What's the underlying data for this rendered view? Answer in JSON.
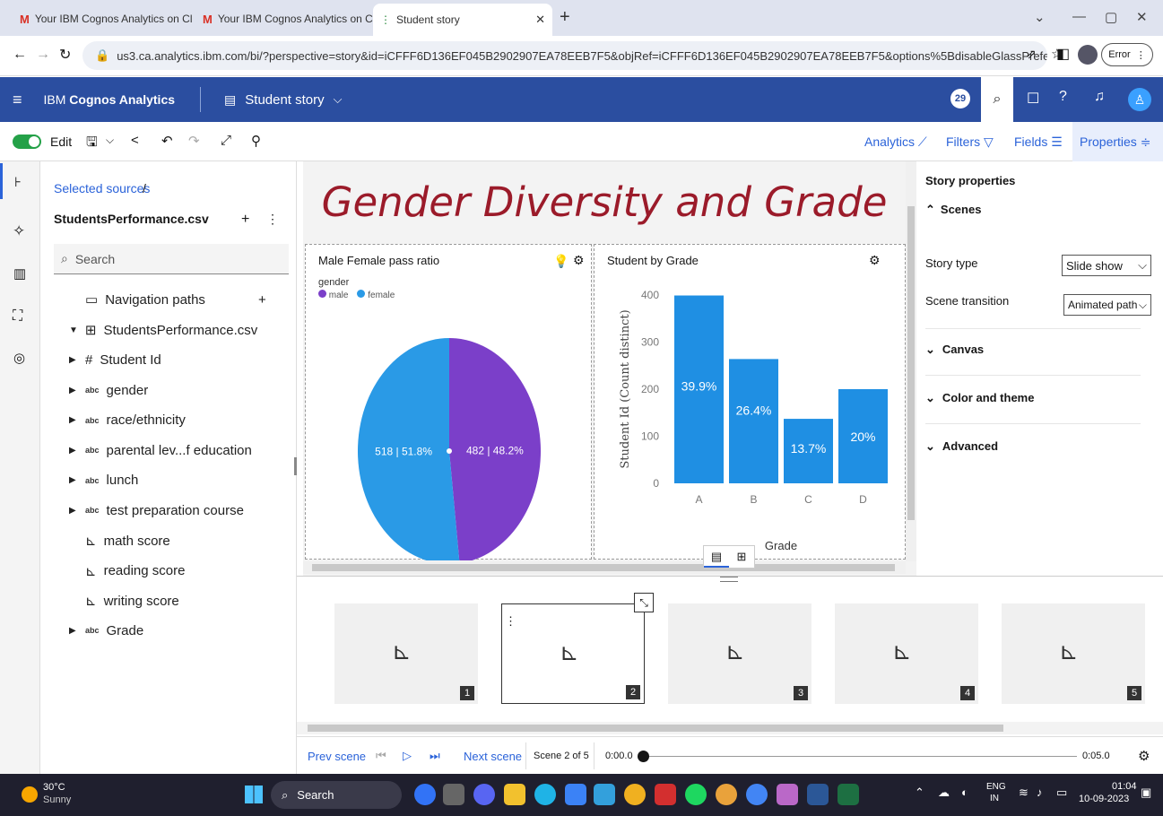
{
  "browser": {
    "tabs": [
      {
        "title": "Your IBM Cognos Analytics on Cl"
      },
      {
        "title": "Your IBM Cognos Analytics on Cl"
      },
      {
        "title": "Student story"
      }
    ],
    "url": "us3.ca.analytics.ibm.com/bi/?perspective=story&id=iCFFF6D136EF045B2902907EA78EEB7F5&objRef=iCFFF6D136EF045B2902907EA78EEB7F5&options%5BdisableGlassPrefetch%5D=true&...",
    "error_label": "Error"
  },
  "app": {
    "brand_prefix": "IBM ",
    "brand_name": "Cognos Analytics",
    "story_name": "Student story",
    "notification_count": "29"
  },
  "toolbar": {
    "edit_label": "Edit",
    "analytics": "Analytics",
    "filters": "Filters",
    "fields": "Fields",
    "properties": "Properties"
  },
  "sources": {
    "selected": "Selected sources",
    "sep": "/",
    "file": "StudentsPerformance.csv",
    "search_placeholder": "Search",
    "nav_paths": "Navigation paths",
    "dataset": "StudentsPerformance.csv",
    "fields": [
      {
        "label": "Student Id",
        "kind": "#",
        "expand": true
      },
      {
        "label": "gender",
        "kind": "abc",
        "expand": true
      },
      {
        "label": "race/ethnicity",
        "kind": "abc",
        "expand": true
      },
      {
        "label": "parental lev...f education",
        "kind": "abc",
        "expand": true
      },
      {
        "label": "lunch",
        "kind": "abc",
        "expand": true
      },
      {
        "label": "test preparation course",
        "kind": "abc",
        "expand": true
      },
      {
        "label": "math score",
        "kind": "measure",
        "expand": false
      },
      {
        "label": "reading score",
        "kind": "measure",
        "expand": false
      },
      {
        "label": "writing score",
        "kind": "measure",
        "expand": false
      },
      {
        "label": "Grade",
        "kind": "abc",
        "expand": true
      }
    ]
  },
  "scene": {
    "title": "Gender Diversity and Grade"
  },
  "chart_data": [
    {
      "type": "pie",
      "title": "Male Female pass ratio",
      "legend_title": "gender",
      "legend_position": "top-left",
      "categories": [
        "male",
        "female"
      ],
      "values": [
        482,
        518
      ],
      "labels": [
        "482 | 48.2%",
        "518 | 51.8%"
      ],
      "colors": [
        "#7b3fc9",
        "#2a9ae6"
      ]
    },
    {
      "type": "bar",
      "title": "Student by Grade",
      "xlabel": "Grade",
      "ylabel": "Student Id (Count distinct)",
      "categories": [
        "A",
        "B",
        "C",
        "D"
      ],
      "values": [
        399,
        264,
        137,
        200
      ],
      "labels": [
        "39.9%",
        "26.4%",
        "13.7%",
        "20%"
      ],
      "yticks": [
        "0",
        "100",
        "200",
        "300",
        "400"
      ],
      "ylim": [
        0,
        400
      ],
      "grid": false,
      "color": "#1f8fe3"
    }
  ],
  "properties": {
    "heading": "Story properties",
    "scenes": "Scenes",
    "story_type_label": "Story type",
    "story_type_value": "Slide show",
    "transition_label": "Scene transition",
    "transition_value": "Animated path",
    "canvas": "Canvas",
    "color_theme": "Color and theme",
    "advanced": "Advanced"
  },
  "timeline": {
    "scenes": [
      "1",
      "2",
      "3",
      "4",
      "5"
    ],
    "prev": "Prev scene",
    "next": "Next scene",
    "position": "Scene 2 of 5",
    "start_time": "0:00.0",
    "end_time": "0:05.0",
    "progress": 0
  },
  "taskbar": {
    "temp": "30°C",
    "weather": "Sunny",
    "search": "Search",
    "lang1": "ENG",
    "lang2": "IN",
    "time": "01:04",
    "date": "10-09-2023"
  }
}
